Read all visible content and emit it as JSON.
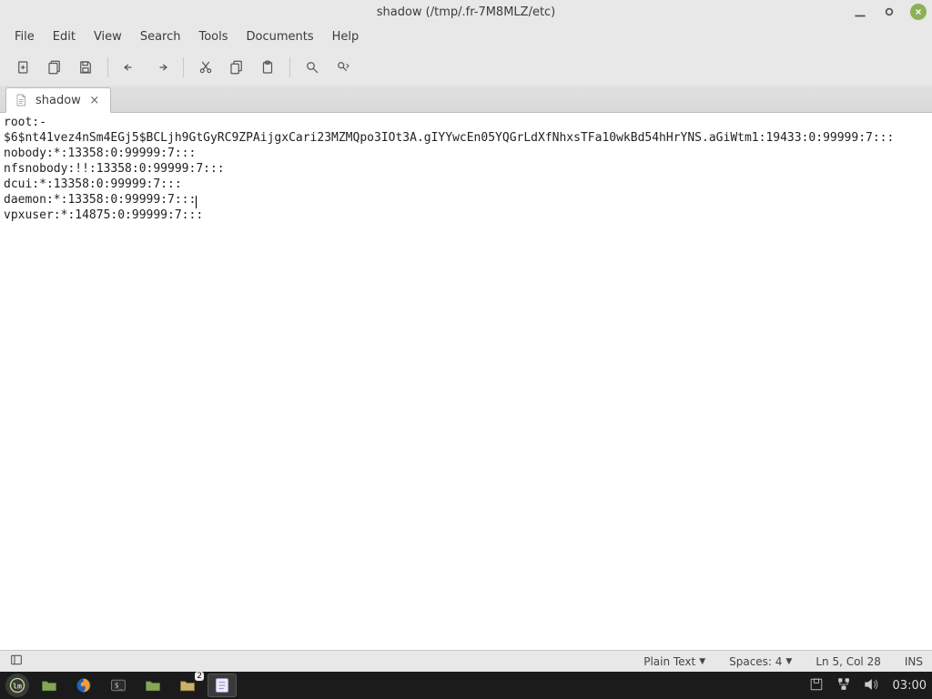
{
  "window": {
    "title": "shadow (/tmp/.fr-7M8MLZ/etc)"
  },
  "menubar": {
    "items": [
      "File",
      "Edit",
      "View",
      "Search",
      "Tools",
      "Documents",
      "Help"
    ]
  },
  "tab": {
    "label": "shadow"
  },
  "editor": {
    "lines": [
      "root:-",
      "$6$nt41vez4nSm4EGj5$BCLjh9GtGyRC9ZPAijgxCari23MZMQpo3IOt3A.gIYYwcEn05YQGrLdXfNhxsTFa10wkBd54hHrYNS.aGiWtm1:19433:0:99999:7:::",
      "nobody:*:13358:0:99999:7:::",
      "nfsnobody:!!:13358:0:99999:7:::",
      "dcui:*:13358:0:99999:7:::",
      "daemon:*:13358:0:99999:7:::",
      "vpxuser:*:14875:0:99999:7:::"
    ],
    "cursor_line_index": 5
  },
  "statusbar": {
    "syntax": "Plain Text",
    "indent": "Spaces: 4",
    "position": "Ln 5, Col 28",
    "mode": "INS"
  },
  "taskbar": {
    "badge_count": "2",
    "clock": "03:00"
  }
}
